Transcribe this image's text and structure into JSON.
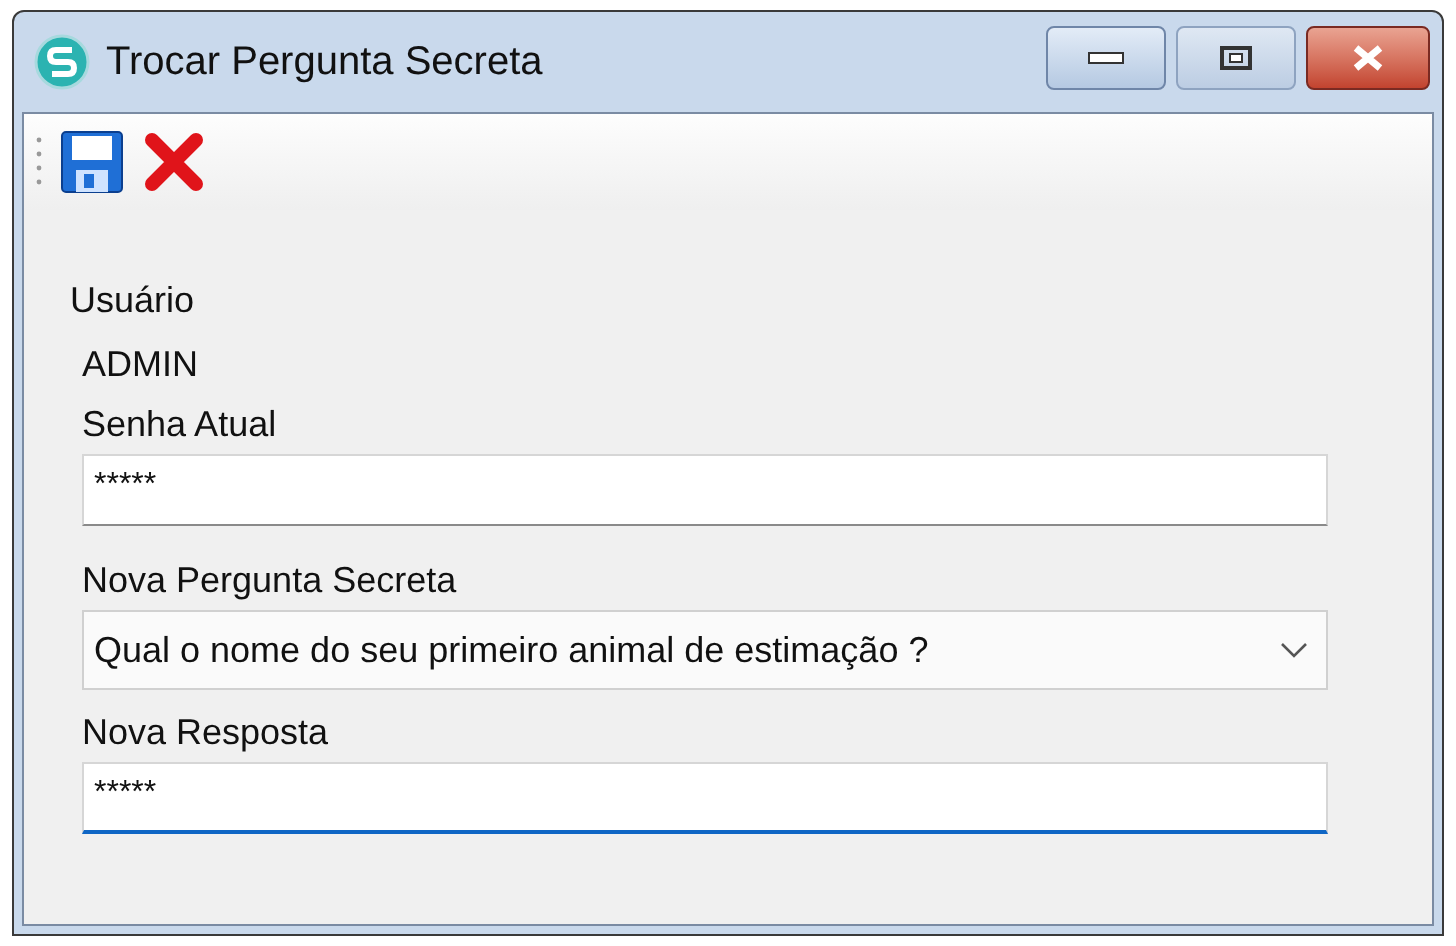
{
  "window": {
    "title": "Trocar Pergunta Secreta"
  },
  "toolbar": [
    {
      "kind": "save"
    },
    {
      "kind": "cancel"
    }
  ],
  "form": [
    {
      "kind": "label",
      "text": "Usuário"
    },
    {
      "kind": "value",
      "text": "ADMIN"
    },
    {
      "kind": "label",
      "text": "Senha Atual"
    },
    {
      "kind": "field",
      "value": "*****",
      "focused": false
    },
    {
      "kind": "label",
      "text": "Nova Pergunta Secreta"
    },
    {
      "kind": "dropdown",
      "value": "Qual o nome do seu primeiro animal de estimação ?"
    },
    {
      "kind": "label",
      "text": "Nova Resposta"
    },
    {
      "kind": "field",
      "value": "*****",
      "focused": true
    }
  ]
}
